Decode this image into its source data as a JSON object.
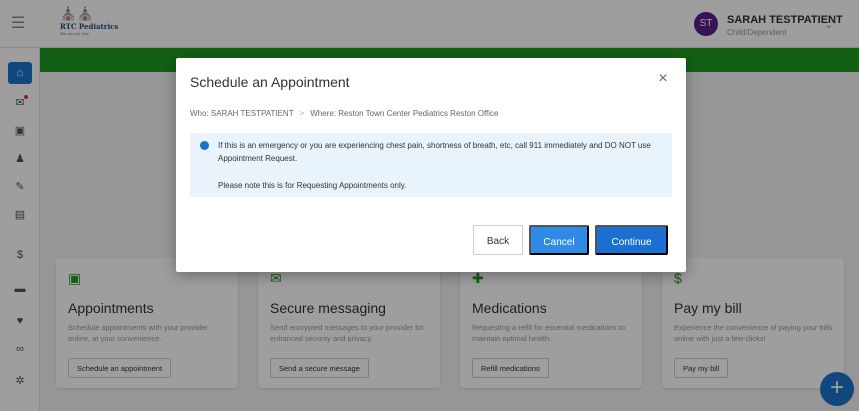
{
  "header": {
    "logo_mark": "⛪⛪",
    "logo_name": "RTC Pediatrics",
    "logo_tag": "We care for kids",
    "user_initials": "ST",
    "user_name": "SARAH TESTPATIENT",
    "user_subtitle": "Child/Dependent"
  },
  "sidebar": {
    "items": [
      "home-icon",
      "mail-icon",
      "calendar-icon",
      "user-icon",
      "edit-icon",
      "document-icon",
      "billing-icon",
      "folder-icon",
      "health-icon",
      "link-icon",
      "settings-icon"
    ]
  },
  "cards": [
    {
      "title": "Appointments",
      "desc": "Schedule appointments with your provider online, at your convenience.",
      "button": "Schedule an appointment",
      "icon": "calendar-icon"
    },
    {
      "title": "Secure messaging",
      "desc": "Send encrypted messages to your provider for enhanced security and privacy.",
      "button": "Send a secure message",
      "icon": "mail-icon"
    },
    {
      "title": "Medications",
      "desc": "Requesting a refill for essential medications to maintain optimal health.",
      "button": "Refill medications",
      "icon": "medication-icon"
    },
    {
      "title": "Pay my bill",
      "desc": "Experience the convenience of paying your bills online with just a few clicks!",
      "button": "Pay my bill",
      "icon": "dollar-icon"
    }
  ],
  "modal": {
    "title": "Schedule an Appointment",
    "close": "×",
    "who": "Who: SARAH TESTPATIENT",
    "separator": ">",
    "where": "Where: Reston Town Center Pediatrics Reston Office",
    "alert_text": "If this is an emergency or you are experiencing chest pain, shortness of breath, etc, call 911 immediately and DO NOT use Appointment Request.",
    "alert_note": "Please note this is for Requesting Appointments only.",
    "back_label": "Back",
    "cancel_label": "Cancel",
    "continue_label": "Continue"
  },
  "fab_label": "+"
}
